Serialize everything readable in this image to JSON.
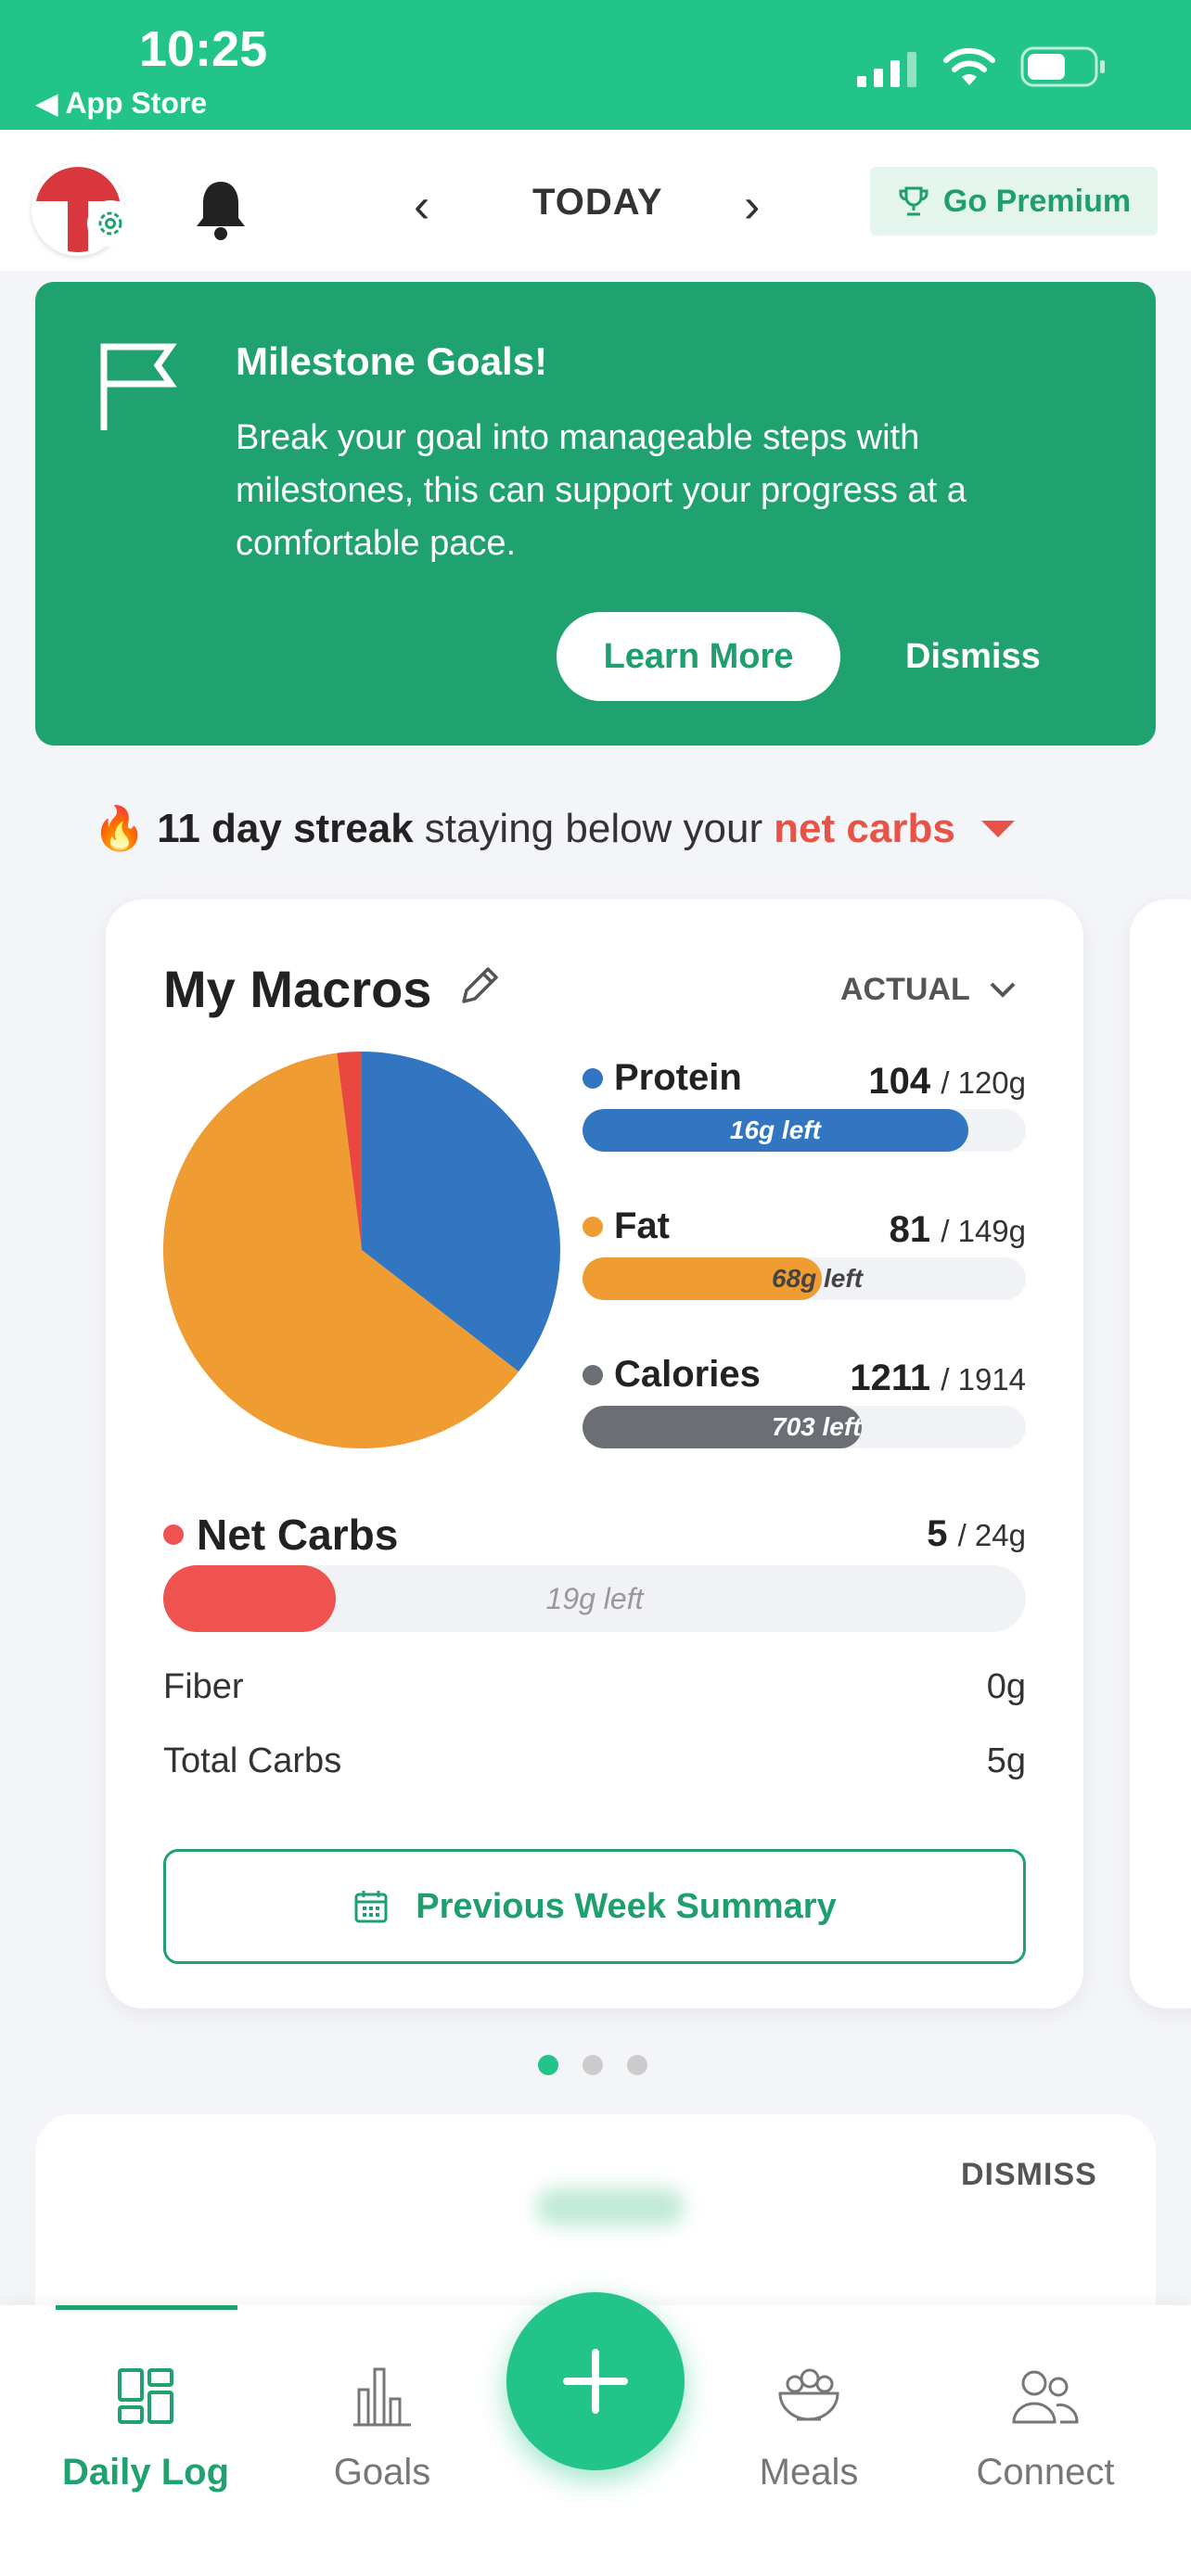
{
  "status_bar": {
    "time": "10:25",
    "back_label": "◀ App Store"
  },
  "nav": {
    "title": "TODAY",
    "premium_label": "Go Premium"
  },
  "banner": {
    "title": "Milestone Goals!",
    "text": "Break your goal into manageable steps with milestones, this can support your progress at a comfortable pace.",
    "learn_more": "Learn More",
    "dismiss": "Dismiss"
  },
  "streak": {
    "emoji": "🔥",
    "bold": "11 day streak",
    "middle": "staying below your",
    "highlight": "net carbs"
  },
  "macros": {
    "title": "My Macros",
    "mode": "ACTUAL",
    "items": [
      {
        "name": "Protein",
        "value": "104",
        "goal": "/ 120g",
        "left": "16g left",
        "color": "#3275c0",
        "fill_pct": 87
      },
      {
        "name": "Fat",
        "value": "81",
        "goal": "/ 149g",
        "left": "68g left",
        "color": "#ef9c33",
        "fill_pct": 54
      },
      {
        "name": "Calories",
        "value": "1211",
        "goal": "/ 1914",
        "left": "703 left",
        "color": "#6c6e75",
        "fill_pct": 63
      }
    ],
    "pie": [
      {
        "label": "Protein",
        "color": "#3275c0",
        "fraction": 0.355
      },
      {
        "label": "Fat",
        "color": "#ef9c33",
        "fraction": 0.625
      },
      {
        "label": "Net Carbs",
        "color": "#e8483f",
        "fraction": 0.02
      }
    ],
    "net_carbs": {
      "name": "Net Carbs",
      "value": "5",
      "goal": "/ 24g",
      "left": "19g left",
      "color": "#ef5350",
      "fill_pct": 20
    },
    "fiber": {
      "label": "Fiber",
      "value": "0g"
    },
    "total_carbs": {
      "label": "Total Carbs",
      "value": "5g"
    },
    "prev_week": "Previous Week Summary"
  },
  "bottom_card": {
    "dismiss": "DISMISS"
  },
  "tabs": [
    {
      "label": "Daily Log",
      "icon": "daily-log-icon",
      "active": true
    },
    {
      "label": "Goals",
      "icon": "goals-icon",
      "active": false
    },
    {
      "label": "Meals",
      "icon": "meals-icon",
      "active": false
    },
    {
      "label": "Connect",
      "icon": "connect-icon",
      "active": false
    }
  ],
  "colors": {
    "accent": "#22c48a",
    "banner": "#1fa26f",
    "alert": "#e85347"
  }
}
